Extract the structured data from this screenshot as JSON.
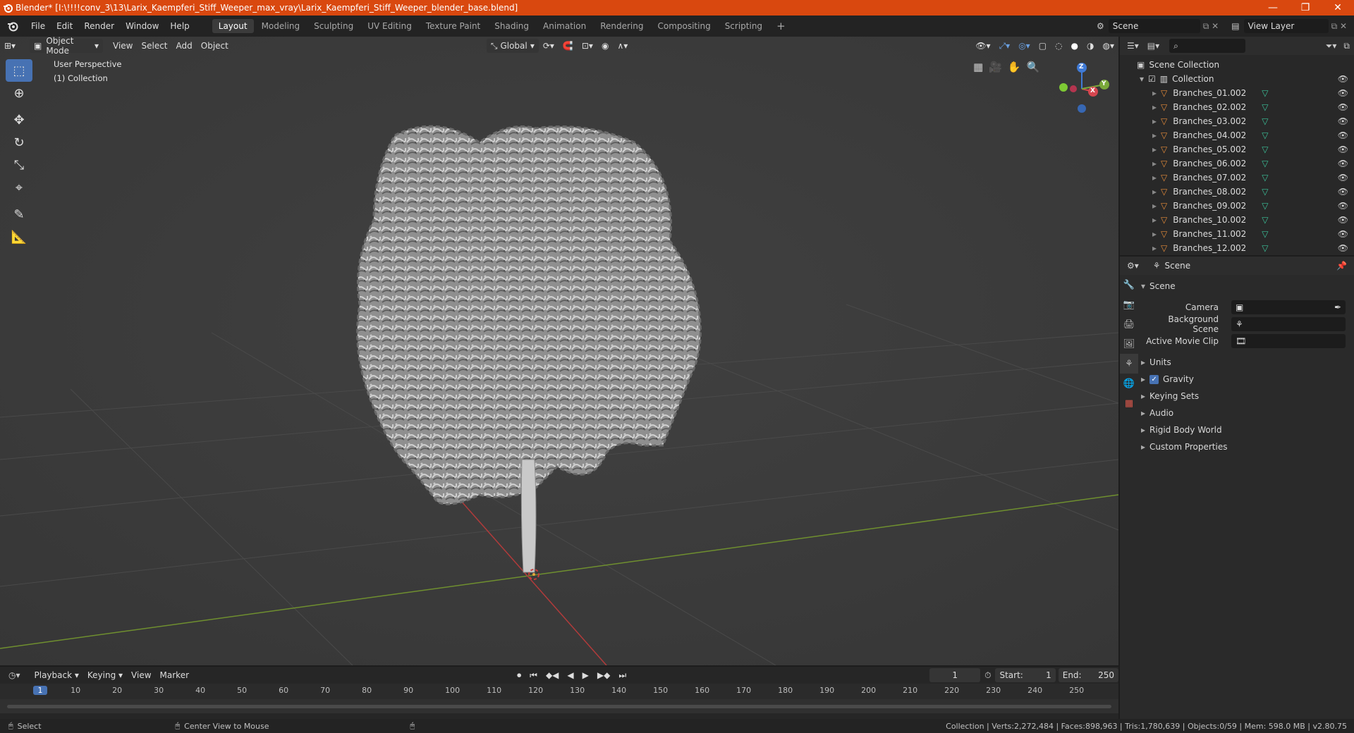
{
  "window": {
    "title": "Blender* [I:\\!!!!conv_3\\13\\Larix_Kaempferi_Stiff_Weeper_max_vray\\Larix_Kaempferi_Stiff_Weeper_blender_base.blend]",
    "controls": [
      "—",
      "❐",
      "✕"
    ]
  },
  "menu": [
    "File",
    "Edit",
    "Render",
    "Window",
    "Help"
  ],
  "workspaces": [
    "Layout",
    "Modeling",
    "Sculpting",
    "UV Editing",
    "Texture Paint",
    "Shading",
    "Animation",
    "Rendering",
    "Compositing",
    "Scripting"
  ],
  "scene_field": "Scene",
  "view_layer_field": "View Layer",
  "viewport_header": {
    "mode": "Object Mode",
    "menus": [
      "View",
      "Select",
      "Add",
      "Object"
    ],
    "orientation": "Global"
  },
  "viewport": {
    "perspective": "User Perspective",
    "collection": "(1) Collection",
    "gizmo": {
      "z": "Z",
      "x": "X",
      "y": "Y"
    }
  },
  "outliner": {
    "root": "Scene Collection",
    "collection": "Collection",
    "items": [
      "Branches_01.002",
      "Branches_02.002",
      "Branches_03.002",
      "Branches_04.002",
      "Branches_05.002",
      "Branches_06.002",
      "Branches_07.002",
      "Branches_08.002",
      "Branches_09.002",
      "Branches_10.002",
      "Branches_11.002",
      "Branches_12.002"
    ]
  },
  "properties": {
    "context": "Scene",
    "panel": "Scene",
    "camera_label": "Camera",
    "background_scene_label": "Background Scene",
    "active_movie_clip_label": "Active Movie Clip",
    "subpanels": [
      "Units",
      "Gravity",
      "Keying Sets",
      "Audio",
      "Rigid Body World",
      "Custom Properties"
    ]
  },
  "timeline": {
    "menus": [
      "Playback",
      "Keying",
      "View",
      "Marker"
    ],
    "current_frame": "1",
    "start_label": "Start:",
    "start": "1",
    "end_label": "End:",
    "end": "250",
    "ruler": [
      "1",
      "10",
      "20",
      "30",
      "40",
      "50",
      "60",
      "70",
      "80",
      "90",
      "100",
      "110",
      "120",
      "130",
      "140",
      "150",
      "160",
      "170",
      "180",
      "190",
      "200",
      "210",
      "220",
      "230",
      "240",
      "250"
    ]
  },
  "status": {
    "left": "Select",
    "middle": "Center View to Mouse",
    "right": "Collection | Verts:2,272,484 | Faces:898,963 | Tris:1,780,639 | Objects:0/59 | Mem: 598.0 MB | v2.80.75"
  },
  "colors": {
    "accent": "#4772b3",
    "titlebar": "#d9480f",
    "mesh_icon": "#e58b3a",
    "data_icon": "#3bc29a"
  }
}
